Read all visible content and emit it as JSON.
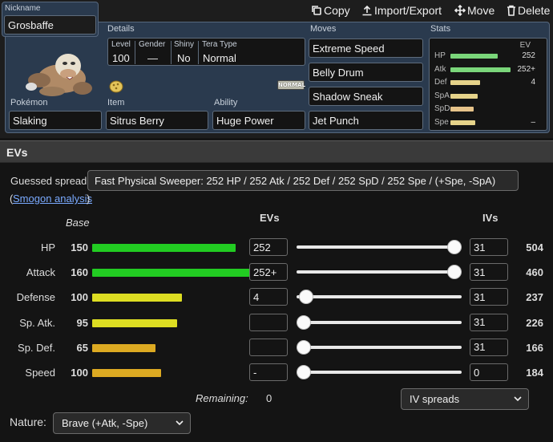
{
  "toolbar": {
    "copy_label": "Copy",
    "import_label": "Import/Export",
    "move_label": "Move",
    "delete_label": "Delete"
  },
  "set": {
    "nickname_label": "Nickname",
    "nickname": "Grosbaffe",
    "details_label": "Details",
    "level_label": "Level",
    "level": "100",
    "gender_label": "Gender",
    "gender": "—",
    "shiny_label": "Shiny",
    "shiny": "No",
    "tera_label": "Tera Type",
    "tera": "Normal",
    "type_badge": "NORMAL",
    "pokemon_label": "Pokémon",
    "pokemon": "Slaking",
    "item_label": "Item",
    "item": "Sitrus Berry",
    "ability_label": "Ability",
    "ability": "Huge Power",
    "moves_label": "Moves",
    "moves": [
      "Extreme Speed",
      "Belly Drum",
      "Shadow Sneak",
      "Jet Punch"
    ],
    "stats_label": "Stats",
    "ev_col_label": "EV",
    "stat_summary": [
      {
        "name": "HP",
        "ev": "252",
        "fill": 0.72,
        "color": "#7ad67a"
      },
      {
        "name": "Atk",
        "ev": "252+",
        "fill": 0.92,
        "color": "#7ad67a"
      },
      {
        "name": "Def",
        "ev": "4",
        "fill": 0.45,
        "color": "#e6d38a"
      },
      {
        "name": "SpA",
        "ev": "",
        "fill": 0.42,
        "color": "#e6d38a"
      },
      {
        "name": "SpD",
        "ev": "",
        "fill": 0.35,
        "color": "#e6c38a"
      },
      {
        "name": "Spe",
        "ev": "–",
        "fill": 0.38,
        "color": "#e6d38a"
      }
    ]
  },
  "evs": {
    "section_title": "EVs",
    "guessed_label": "Guessed spread:",
    "guessed_value": "Fast Physical Sweeper: 252 HP / 252 Atk / 252 Def / 252 SpD / 252 Spe / (+Spe, -SpA)",
    "paren_open": "(",
    "smogon_link": "Smogon analysis",
    "paren_close": ")",
    "base_header": "Base",
    "evs_header": "EVs",
    "ivs_header": "IVs",
    "stats": [
      {
        "name": "HP",
        "base": "150",
        "base_fill": 0.59,
        "bar_color": "#22cc22",
        "ev": "252",
        "ev_level": 1.0,
        "iv": "31",
        "total": "504"
      },
      {
        "name": "Attack",
        "base": "160",
        "base_fill": 0.71,
        "bar_color": "#22cc22",
        "ev": "252+",
        "ev_level": 1.0,
        "iv": "31",
        "total": "460"
      },
      {
        "name": "Defense",
        "base": "100",
        "base_fill": 0.37,
        "bar_color": "#dddd22",
        "ev": "4",
        "ev_level": 0.016,
        "iv": "31",
        "total": "237"
      },
      {
        "name": "Sp. Atk.",
        "base": "95",
        "base_fill": 0.35,
        "bar_color": "#dddd22",
        "ev": "",
        "ev_level": 0,
        "iv": "31",
        "total": "226"
      },
      {
        "name": "Sp. Def.",
        "base": "65",
        "base_fill": 0.26,
        "bar_color": "#ddaa22",
        "ev": "",
        "ev_level": 0,
        "iv": "31",
        "total": "166"
      },
      {
        "name": "Speed",
        "base": "100",
        "base_fill": 0.285,
        "bar_color": "#ddaa22",
        "ev": "-",
        "ev_level": 0,
        "iv": "0",
        "total": "184"
      }
    ],
    "remaining_label": "Remaining:",
    "remaining_value": "0",
    "iv_spreads_label": "IV spreads",
    "nature_label": "Nature:",
    "nature_value": "Brave (+Atk, -Spe)"
  }
}
